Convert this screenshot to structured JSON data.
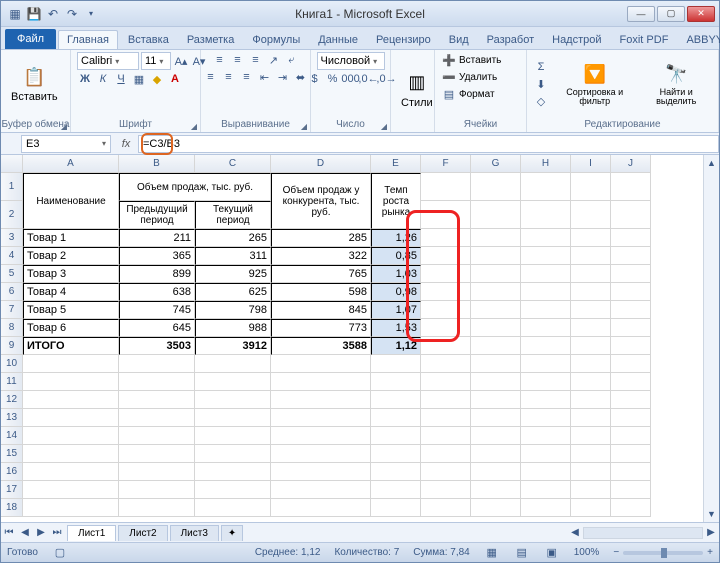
{
  "title": "Книга1 - Microsoft Excel",
  "tabs": {
    "file": "Файл",
    "home": "Главная",
    "insert": "Вставка",
    "layout": "Разметка",
    "formulas": "Формулы",
    "data": "Данные",
    "review": "Рецензиро",
    "view": "Вид",
    "developer": "Разработ",
    "addins": "Надстрой",
    "foxit": "Foxit PDF",
    "abbyy": "ABBYY PD"
  },
  "ribbon": {
    "paste": "Вставить",
    "clipboard": "Буфер обмена",
    "font_name": "Calibri",
    "font_size": "11",
    "font": "Шрифт",
    "alignment": "Выравнивание",
    "number_format": "Числовой",
    "number": "Число",
    "styles": "Стили",
    "insert_btn": "Вставить",
    "delete_btn": "Удалить",
    "format_btn": "Формат",
    "cells": "Ячейки",
    "sort_filter": "Сортировка и фильтр",
    "find_select": "Найти и выделить",
    "editing": "Редактирование"
  },
  "namebox": "E3",
  "formula": "=C3/B3",
  "columns": [
    "A",
    "B",
    "C",
    "D",
    "E",
    "F",
    "G",
    "H",
    "I",
    "J"
  ],
  "headers": {
    "name": "Наименование",
    "sales": "Объем продаж, тыс. руб.",
    "prev": "Предыдущий период",
    "curr": "Текущий период",
    "competitor": "Объем продаж у конкурента, тыс. руб.",
    "growth": "Темп роста рынка"
  },
  "rows": [
    {
      "n": "Товар 1",
      "b": "211",
      "c": "265",
      "d": "285",
      "e": "1,26"
    },
    {
      "n": "Товар 2",
      "b": "365",
      "c": "311",
      "d": "322",
      "e": "0,85"
    },
    {
      "n": "Товар 3",
      "b": "899",
      "c": "925",
      "d": "765",
      "e": "1,03"
    },
    {
      "n": "Товар 4",
      "b": "638",
      "c": "625",
      "d": "598",
      "e": "0,98"
    },
    {
      "n": "Товар 5",
      "b": "745",
      "c": "798",
      "d": "845",
      "e": "1,07"
    },
    {
      "n": "Товар 6",
      "b": "645",
      "c": "988",
      "d": "773",
      "e": "1,53"
    }
  ],
  "total": {
    "n": "ИТОГО",
    "b": "3503",
    "c": "3912",
    "d": "3588",
    "e": "1,12"
  },
  "sheets": {
    "s1": "Лист1",
    "s2": "Лист2",
    "s3": "Лист3"
  },
  "status": {
    "ready": "Готово",
    "avg_label": "Среднее:",
    "avg": "1,12",
    "count_label": "Количество:",
    "count": "7",
    "sum_label": "Сумма:",
    "sum": "7,84",
    "zoom": "100%"
  },
  "chart_data": {
    "type": "table",
    "columns": [
      "Наименование",
      "Предыдущий период",
      "Текущий период",
      "Объем продаж у конкурента, тыс. руб.",
      "Темп роста рынка"
    ],
    "data": [
      [
        "Товар 1",
        211,
        265,
        285,
        1.26
      ],
      [
        "Товар 2",
        365,
        311,
        322,
        0.85
      ],
      [
        "Товар 3",
        899,
        925,
        765,
        1.03
      ],
      [
        "Товар 4",
        638,
        625,
        598,
        0.98
      ],
      [
        "Товар 5",
        745,
        798,
        845,
        1.07
      ],
      [
        "Товар 6",
        645,
        988,
        773,
        1.53
      ],
      [
        "ИТОГО",
        3503,
        3912,
        3588,
        1.12
      ]
    ]
  }
}
